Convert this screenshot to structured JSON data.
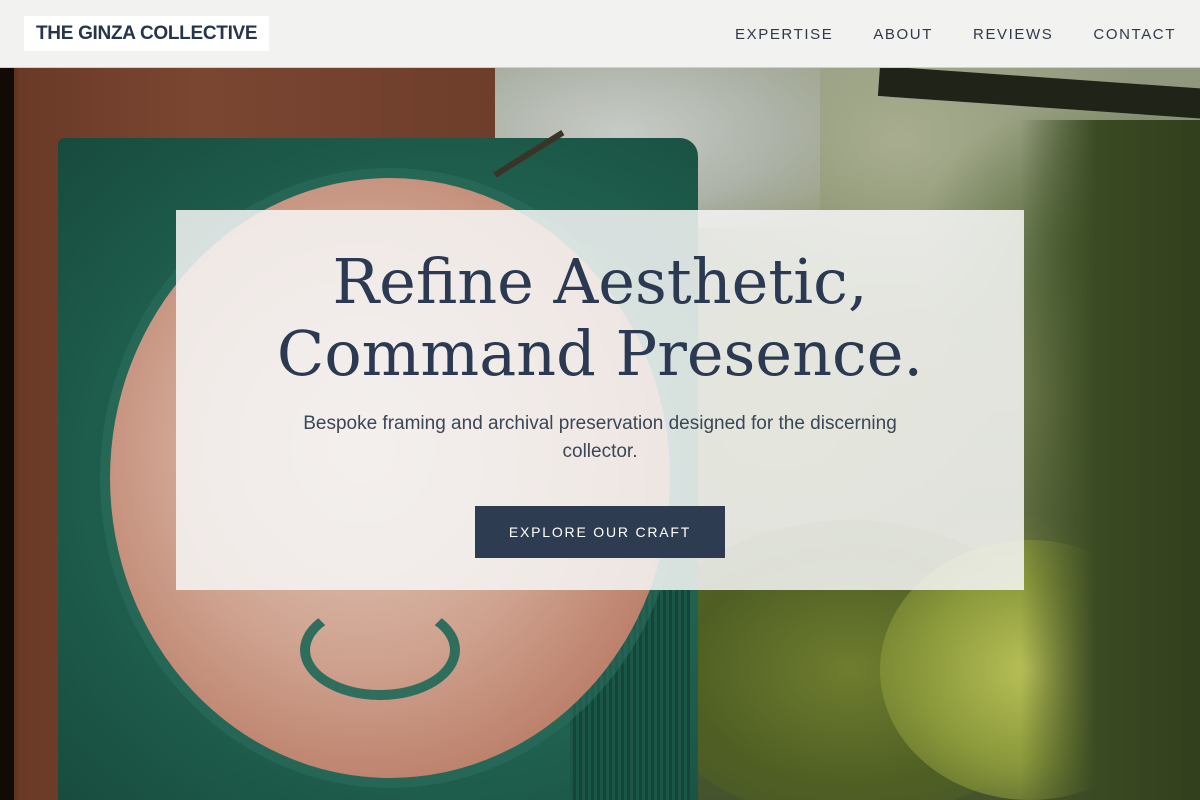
{
  "brand": {
    "name": "THE GINZA COLLECTIVE"
  },
  "nav": {
    "items": [
      {
        "label": "EXPERTISE"
      },
      {
        "label": "ABOUT"
      },
      {
        "label": "REVIEWS"
      },
      {
        "label": "CONTACT"
      }
    ]
  },
  "hero": {
    "title_line1": "Refine Aesthetic,",
    "title_line2": "Command Presence.",
    "subtitle": "Bespoke framing and archival preservation designed for the discerning collector.",
    "cta_label": "EXPLORE OUR CRAFT",
    "background_description_icon": "hero-background-image"
  },
  "colors": {
    "primary": "#2e3c51",
    "heading": "#2b3a52",
    "header_bg": "#f5f5f5",
    "card_bg": "#f6f6f6"
  }
}
